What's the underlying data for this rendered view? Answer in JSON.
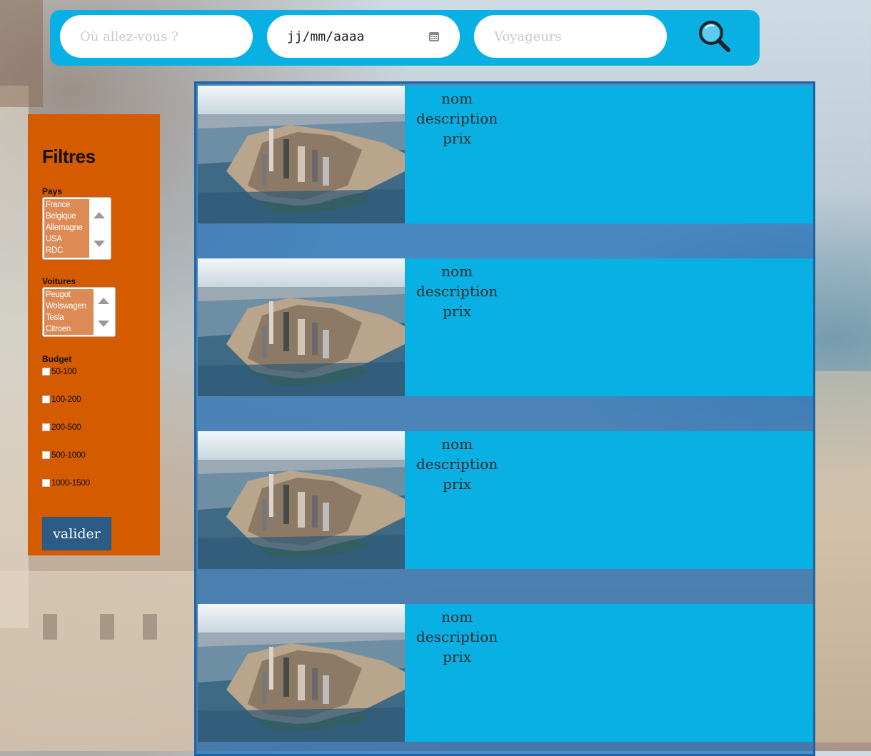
{
  "search": {
    "destination_placeholder": "Où allez-vous ?",
    "date_value": "jj/mm/aaaa",
    "travelers_placeholder": "Voyageurs"
  },
  "filters": {
    "title": "Filtres",
    "countries_label": "Pays",
    "countries": [
      "France",
      "Belgique",
      "Allemagne",
      "USA",
      "RDC"
    ],
    "cars_label": "Voitures",
    "cars": [
      "Peugot",
      "Wolswagen",
      "Tesla",
      "Citroen"
    ],
    "budget_label": "Budget",
    "budget_options": [
      "50-100",
      "100-200",
      "200-500",
      "500-1000",
      "1000-1500"
    ],
    "submit_label": "valider"
  },
  "results": [
    {
      "name": "nom",
      "description": "description",
      "price": "prix"
    },
    {
      "name": "nom",
      "description": "description",
      "price": "prix"
    },
    {
      "name": "nom",
      "description": "description",
      "price": "prix"
    },
    {
      "name": "nom",
      "description": "description",
      "price": "prix"
    }
  ],
  "colors": {
    "search_bar": "#08b0e3",
    "filters_panel": "#d45b00",
    "card": "#08b0e3",
    "button": "#2a5c86"
  }
}
